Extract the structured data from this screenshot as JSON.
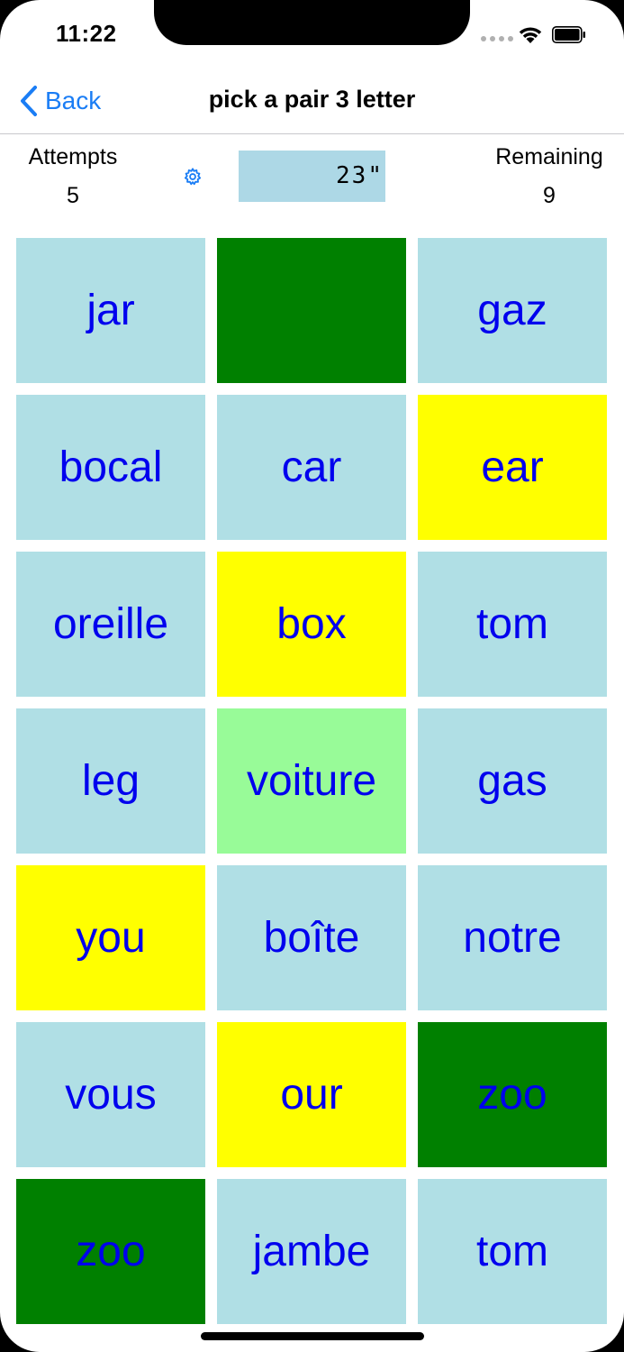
{
  "status_bar": {
    "time": "11:22"
  },
  "nav": {
    "back_label": "Back",
    "title": "pick a pair 3 letter"
  },
  "stats": {
    "attempts_label": "Attempts",
    "attempts_value": "5",
    "timer": "23\"",
    "remaining_label": "Remaining",
    "remaining_value": "9"
  },
  "colors": {
    "accent": "#1a7df5",
    "tile_default": "#b0dfe5",
    "tile_selected": "#ffff00",
    "tile_matched": "#008000",
    "tile_hint": "#98fb98",
    "tile_text": "#0000ee",
    "timer_bg": "#add8e6"
  },
  "tiles": [
    {
      "word": "jar",
      "state": "default"
    },
    {
      "word": "",
      "state": "matched"
    },
    {
      "word": "gaz",
      "state": "default"
    },
    {
      "word": "bocal",
      "state": "default"
    },
    {
      "word": "car",
      "state": "default"
    },
    {
      "word": "ear",
      "state": "selected"
    },
    {
      "word": "oreille",
      "state": "default"
    },
    {
      "word": "box",
      "state": "selected"
    },
    {
      "word": "tom",
      "state": "default"
    },
    {
      "word": "leg",
      "state": "default"
    },
    {
      "word": "voiture",
      "state": "hint"
    },
    {
      "word": "gas",
      "state": "default"
    },
    {
      "word": "you",
      "state": "selected"
    },
    {
      "word": "boîte",
      "state": "default"
    },
    {
      "word": "notre",
      "state": "default"
    },
    {
      "word": "vous",
      "state": "default"
    },
    {
      "word": "our",
      "state": "selected"
    },
    {
      "word": "zoo",
      "state": "matched"
    },
    {
      "word": "zoo",
      "state": "matched"
    },
    {
      "word": "jambe",
      "state": "default"
    },
    {
      "word": "tom",
      "state": "default"
    }
  ]
}
